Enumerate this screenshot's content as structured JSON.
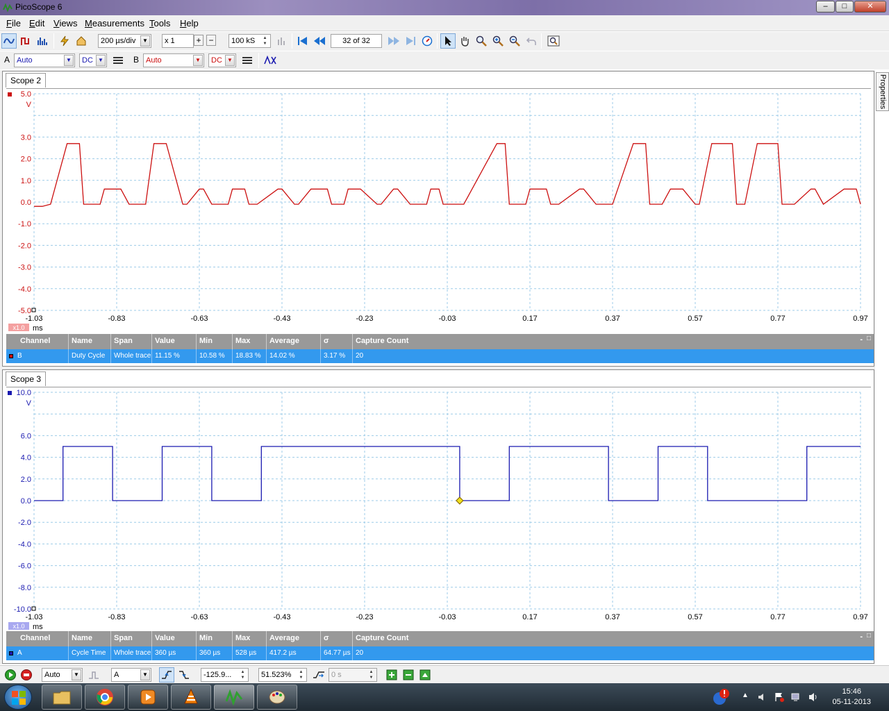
{
  "window": {
    "title": "PicoScope 6",
    "minimize": "‒",
    "maximize": "□",
    "close": "✕"
  },
  "menu": [
    {
      "accel": "F",
      "rest": "ile"
    },
    {
      "accel": "E",
      "rest": "dit"
    },
    {
      "accel": "V",
      "rest": "iews"
    },
    {
      "accel": "M",
      "rest": "easurements"
    },
    {
      "accel": "T",
      "rest": "ools"
    },
    {
      "accel": "H",
      "rest": "elp"
    }
  ],
  "toolbar": {
    "timebase": "200 µs/div",
    "zoom": "x 1",
    "samples": "100 kS",
    "buffer": "32 of 32"
  },
  "channels": {
    "a_label": "A",
    "a_range": "Auto",
    "a_coupling": "DC",
    "b_label": "B",
    "b_range": "Auto",
    "b_coupling": "DC"
  },
  "properties_tab": "Properties",
  "colors": {
    "channel_a": "#1a1ab0",
    "channel_b": "#cc1111",
    "selected_row": "#3399ee",
    "header": "#999999"
  },
  "scopes": [
    {
      "tab": "Scope 2",
      "y_unit": "V",
      "x_unit": "ms",
      "zoom_badge": "x1.0",
      "y_ticks": [
        "5.0",
        "3.0",
        "2.0",
        "1.0",
        "0.0",
        "-1.0",
        "-2.0",
        "-3.0",
        "-4.0",
        "-5.0"
      ],
      "x_ticks": [
        "-1.03",
        "-0.83",
        "-0.63",
        "-0.43",
        "-0.23",
        "-0.03",
        "0.17",
        "0.37",
        "0.57",
        "0.77",
        "0.97"
      ],
      "measurement": {
        "channel": "B",
        "name": "Duty Cycle",
        "span": "Whole trace",
        "value": "11.15 %",
        "min": "10.58 %",
        "max": "18.83 %",
        "average": "14.02 %",
        "sigma": "3.17 %",
        "capture_count": "20"
      }
    },
    {
      "tab": "Scope 3",
      "y_unit": "V",
      "x_unit": "ms",
      "zoom_badge": "x1.0",
      "y_ticks": [
        "10.0",
        "6.0",
        "4.0",
        "2.0",
        "0.0",
        "-2.0",
        "-4.0",
        "-6.0",
        "-8.0",
        "-10.0"
      ],
      "x_ticks": [
        "-1.03",
        "-0.83",
        "-0.63",
        "-0.43",
        "-0.23",
        "-0.03",
        "0.17",
        "0.37",
        "0.57",
        "0.77",
        "0.97"
      ],
      "measurement": {
        "channel": "A",
        "name": "Cycle Time",
        "span": "Whole trace",
        "value": "360 µs",
        "min": "360 µs",
        "max": "528 µs",
        "average": "417.2 µs",
        "sigma": "64.77 µs",
        "capture_count": "20"
      }
    }
  ],
  "meas_headers": [
    "Channel",
    "Name",
    "Span",
    "Value",
    "Min",
    "Max",
    "Average",
    "σ",
    "Capture Count"
  ],
  "statusbar": {
    "trigger_mode": "Auto",
    "trigger_source": "A",
    "trigger_time": "-125.9...",
    "pretrigger": "51.523%",
    "delay": "0 s"
  },
  "taskbar": {
    "time": "15:46",
    "date": "05-11-2013"
  },
  "chart_data": [
    {
      "type": "line",
      "xlabel": "ms",
      "ylabel": "V",
      "xlim": [
        -1.03,
        0.97
      ],
      "ylim": [
        -5,
        5
      ],
      "series": [
        {
          "name": "B",
          "color": "#cc1111",
          "x": [
            -1.03,
            -1.01,
            -0.99,
            -0.95,
            -0.92,
            -0.91,
            -0.87,
            -0.86,
            -0.82,
            -0.8,
            -0.79,
            -0.76,
            -0.74,
            -0.71,
            -0.67,
            -0.66,
            -0.63,
            -0.62,
            -0.6,
            -0.56,
            -0.55,
            -0.52,
            -0.51,
            -0.49,
            -0.44,
            -0.43,
            -0.4,
            -0.39,
            -0.36,
            -0.32,
            -0.31,
            -0.28,
            -0.27,
            -0.24,
            -0.2,
            -0.19,
            -0.16,
            -0.15,
            -0.12,
            -0.08,
            -0.07,
            -0.05,
            -0.04,
            0.01,
            0.09,
            0.11,
            0.12,
            0.16,
            0.17,
            0.21,
            0.22,
            0.24,
            0.29,
            0.3,
            0.33,
            0.34,
            0.37,
            0.42,
            0.45,
            0.46,
            0.49,
            0.51,
            0.54,
            0.57,
            0.58,
            0.61,
            0.66,
            0.67,
            0.69,
            0.72,
            0.77,
            0.78,
            0.81,
            0.85,
            0.86,
            0.88,
            0.93,
            0.96,
            0.97
          ],
          "y": [
            -0.2,
            -0.2,
            -0.1,
            2.7,
            2.7,
            -0.1,
            -0.1,
            0.6,
            0.6,
            -0.1,
            -0.1,
            -0.1,
            2.7,
            2.7,
            -0.1,
            -0.1,
            0.6,
            0.6,
            -0.1,
            -0.1,
            0.6,
            0.6,
            -0.1,
            -0.1,
            0.6,
            0.6,
            -0.1,
            -0.1,
            0.6,
            0.6,
            -0.1,
            -0.1,
            0.6,
            0.6,
            -0.1,
            -0.1,
            0.6,
            0.6,
            -0.1,
            -0.1,
            0.6,
            0.6,
            -0.1,
            -0.1,
            2.7,
            2.7,
            -0.1,
            -0.1,
            0.6,
            0.6,
            -0.1,
            -0.1,
            0.6,
            0.6,
            -0.1,
            -0.1,
            -0.1,
            2.7,
            2.7,
            -0.1,
            -0.1,
            0.6,
            0.6,
            -0.1,
            -0.1,
            2.7,
            2.7,
            -0.1,
            -0.1,
            2.7,
            2.7,
            -0.1,
            -0.1,
            0.6,
            0.6,
            -0.1,
            0.6,
            0.6,
            -0.1
          ]
        }
      ]
    },
    {
      "type": "line",
      "xlabel": "ms",
      "ylabel": "V",
      "xlim": [
        -1.03,
        0.97
      ],
      "ylim": [
        -10,
        10
      ],
      "series": [
        {
          "name": "A",
          "color": "#1a1ab0",
          "x": [
            -1.03,
            -0.96,
            -0.96,
            -0.84,
            -0.84,
            -0.72,
            -0.72,
            -0.6,
            -0.6,
            -0.48,
            -0.48,
            0.0,
            0.0,
            0.12,
            0.12,
            0.36,
            0.36,
            0.48,
            0.48,
            0.6,
            0.6,
            0.84,
            0.84,
            0.97
          ],
          "y": [
            0,
            0,
            5,
            5,
            0,
            0,
            5,
            5,
            0,
            0,
            5,
            5,
            0,
            0,
            5,
            5,
            0,
            0,
            5,
            5,
            0,
            0,
            5,
            5
          ]
        }
      ]
    }
  ]
}
